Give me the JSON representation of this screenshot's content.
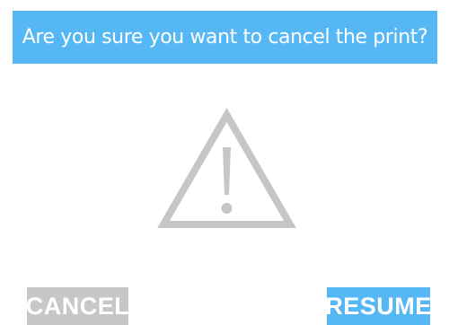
{
  "dialog": {
    "title": "Are you sure you want to cancel the print?",
    "icon": "warning-triangle-icon"
  },
  "buttons": {
    "cancel_label": "CANCEL",
    "resume_label": "RESUME"
  },
  "colors": {
    "accent": "#56b7f5",
    "cancel_button": "#c7c7c7",
    "icon_gray": "#c6c6c6",
    "background": "#ffffff",
    "text_on_accent": "#ffffff"
  }
}
